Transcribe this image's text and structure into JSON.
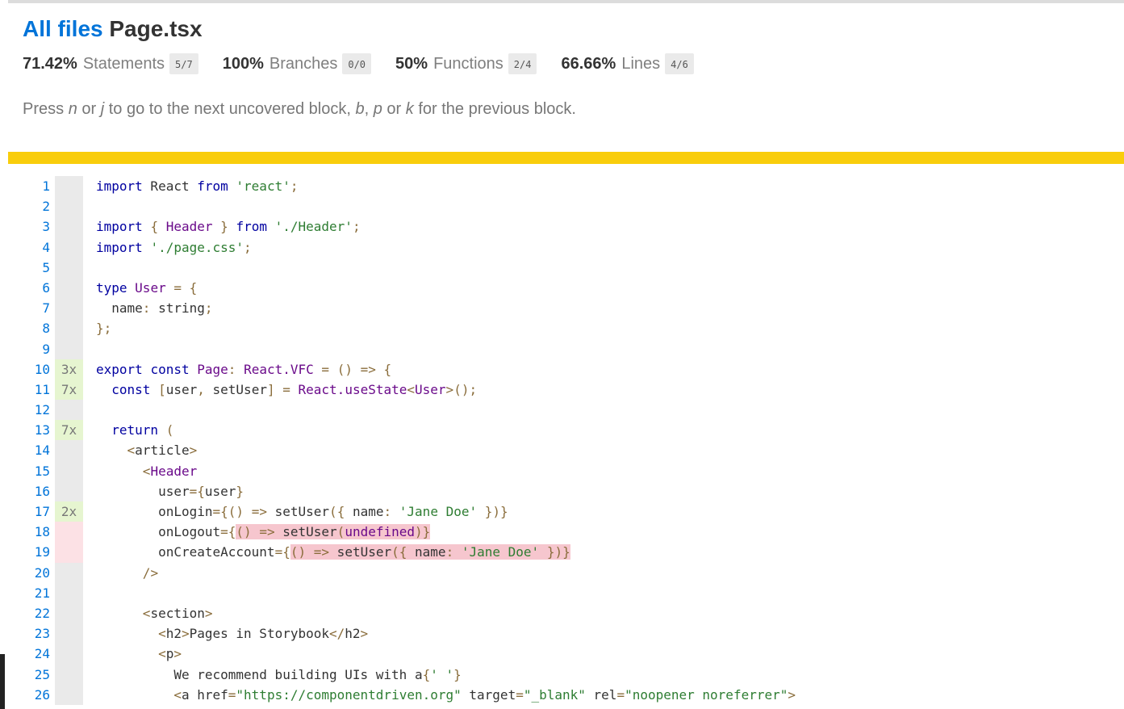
{
  "header": {
    "all_files_label": "All files",
    "file_name": "Page.tsx"
  },
  "stats": [
    {
      "pct": "71.42%",
      "label": "Statements",
      "fraction": "5/7"
    },
    {
      "pct": "100%",
      "label": "Branches",
      "fraction": "0/0"
    },
    {
      "pct": "50%",
      "label": "Functions",
      "fraction": "2/4"
    },
    {
      "pct": "66.66%",
      "label": "Lines",
      "fraction": "4/6"
    }
  ],
  "hint": {
    "p1": "Press ",
    "k1": "n",
    "p2": " or ",
    "k2": "j",
    "p3": " to go to the next uncovered block, ",
    "k3": "b",
    "p4": ", ",
    "k4": "p",
    "p5": " or ",
    "k5": "k",
    "p6": " for the previous block."
  },
  "colors": {
    "link": "#0074D9",
    "status_medium": "#f9cd0b",
    "covered": "#e6f5d0",
    "uncovered": "#fce1e5",
    "uncovered_code": "#f6c6ce"
  },
  "code": {
    "line_numbers": [
      "1",
      "2",
      "3",
      "4",
      "5",
      "6",
      "7",
      "8",
      "9",
      "10",
      "11",
      "12",
      "13",
      "14",
      "15",
      "16",
      "17",
      "18",
      "19",
      "20",
      "21",
      "22",
      "23",
      "24",
      "25",
      "26"
    ],
    "counts": [
      "",
      "",
      "",
      "",
      "",
      "",
      "",
      "",
      "",
      "3x",
      "7x",
      "",
      "7x",
      "",
      "",
      "",
      "2x",
      "",
      "",
      "",
      "",
      "",
      "",
      "",
      "",
      ""
    ],
    "line_status": [
      "neutral",
      "neutral",
      "neutral",
      "neutral",
      "neutral",
      "neutral",
      "neutral",
      "neutral",
      "neutral",
      "yes",
      "yes",
      "neutral",
      "yes",
      "neutral",
      "neutral",
      "neutral",
      "yes",
      "no",
      "no",
      "neutral",
      "neutral",
      "neutral",
      "neutral",
      "neutral",
      "neutral",
      "neutral"
    ],
    "lines": [
      "import React from 'react';",
      "",
      "import { Header } from './Header';",
      "import './page.css';",
      "",
      "type User = {",
      "  name: string;",
      "};",
      "",
      "export const Page: React.VFC = () => {",
      "  const [user, setUser] = React.useState<User>();",
      "",
      "  return (",
      "    <article>",
      "      <Header",
      "        user={user}",
      "        onLogin={() => setUser({ name: 'Jane Doe' })}",
      "        onLogout={() => setUser(undefined)}",
      "        onCreateAccount={() => setUser({ name: 'Jane Doe' })}",
      "      />",
      "",
      "      <section>",
      "        <h2>Pages in Storybook</h2>",
      "        <p>",
      "          We recommend building UIs with a{' '}",
      "          <a href=\"https://componentdriven.org\" target=\"_blank\" rel=\"noopener noreferrer\">"
    ]
  }
}
